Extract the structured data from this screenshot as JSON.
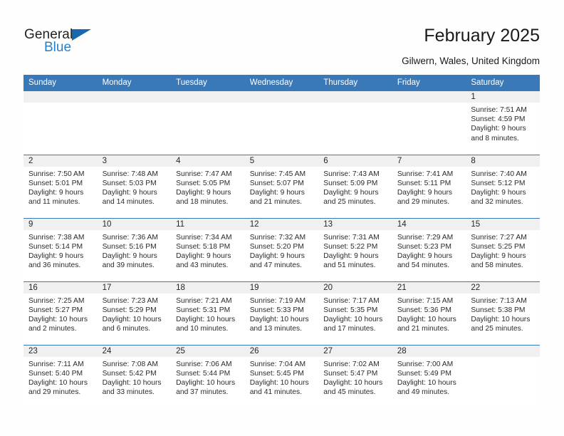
{
  "brand": {
    "name_top": "General",
    "name_bottom": "Blue",
    "color_dark": "#231f20",
    "color_blue": "#2a7fc4"
  },
  "header": {
    "title": "February 2025",
    "subtitle": "Gilwern, Wales, United Kingdom",
    "accent_color": "#3a79b8"
  },
  "calendar": {
    "weekday_headers": [
      "Sunday",
      "Monday",
      "Tuesday",
      "Wednesday",
      "Thursday",
      "Friday",
      "Saturday"
    ],
    "weeks": [
      [
        {
          "day": "",
          "lines": []
        },
        {
          "day": "",
          "lines": []
        },
        {
          "day": "",
          "lines": []
        },
        {
          "day": "",
          "lines": []
        },
        {
          "day": "",
          "lines": []
        },
        {
          "day": "",
          "lines": []
        },
        {
          "day": "1",
          "lines": [
            "Sunrise: 7:51 AM",
            "Sunset: 4:59 PM",
            "Daylight: 9 hours and 8 minutes."
          ]
        }
      ],
      [
        {
          "day": "2",
          "lines": [
            "Sunrise: 7:50 AM",
            "Sunset: 5:01 PM",
            "Daylight: 9 hours and 11 minutes."
          ]
        },
        {
          "day": "3",
          "lines": [
            "Sunrise: 7:48 AM",
            "Sunset: 5:03 PM",
            "Daylight: 9 hours and 14 minutes."
          ]
        },
        {
          "day": "4",
          "lines": [
            "Sunrise: 7:47 AM",
            "Sunset: 5:05 PM",
            "Daylight: 9 hours and 18 minutes."
          ]
        },
        {
          "day": "5",
          "lines": [
            "Sunrise: 7:45 AM",
            "Sunset: 5:07 PM",
            "Daylight: 9 hours and 21 minutes."
          ]
        },
        {
          "day": "6",
          "lines": [
            "Sunrise: 7:43 AM",
            "Sunset: 5:09 PM",
            "Daylight: 9 hours and 25 minutes."
          ]
        },
        {
          "day": "7",
          "lines": [
            "Sunrise: 7:41 AM",
            "Sunset: 5:11 PM",
            "Daylight: 9 hours and 29 minutes."
          ]
        },
        {
          "day": "8",
          "lines": [
            "Sunrise: 7:40 AM",
            "Sunset: 5:12 PM",
            "Daylight: 9 hours and 32 minutes."
          ]
        }
      ],
      [
        {
          "day": "9",
          "lines": [
            "Sunrise: 7:38 AM",
            "Sunset: 5:14 PM",
            "Daylight: 9 hours and 36 minutes."
          ]
        },
        {
          "day": "10",
          "lines": [
            "Sunrise: 7:36 AM",
            "Sunset: 5:16 PM",
            "Daylight: 9 hours and 39 minutes."
          ]
        },
        {
          "day": "11",
          "lines": [
            "Sunrise: 7:34 AM",
            "Sunset: 5:18 PM",
            "Daylight: 9 hours and 43 minutes."
          ]
        },
        {
          "day": "12",
          "lines": [
            "Sunrise: 7:32 AM",
            "Sunset: 5:20 PM",
            "Daylight: 9 hours and 47 minutes."
          ]
        },
        {
          "day": "13",
          "lines": [
            "Sunrise: 7:31 AM",
            "Sunset: 5:22 PM",
            "Daylight: 9 hours and 51 minutes."
          ]
        },
        {
          "day": "14",
          "lines": [
            "Sunrise: 7:29 AM",
            "Sunset: 5:23 PM",
            "Daylight: 9 hours and 54 minutes."
          ]
        },
        {
          "day": "15",
          "lines": [
            "Sunrise: 7:27 AM",
            "Sunset: 5:25 PM",
            "Daylight: 9 hours and 58 minutes."
          ]
        }
      ],
      [
        {
          "day": "16",
          "lines": [
            "Sunrise: 7:25 AM",
            "Sunset: 5:27 PM",
            "Daylight: 10 hours and 2 minutes."
          ]
        },
        {
          "day": "17",
          "lines": [
            "Sunrise: 7:23 AM",
            "Sunset: 5:29 PM",
            "Daylight: 10 hours and 6 minutes."
          ]
        },
        {
          "day": "18",
          "lines": [
            "Sunrise: 7:21 AM",
            "Sunset: 5:31 PM",
            "Daylight: 10 hours and 10 minutes."
          ]
        },
        {
          "day": "19",
          "lines": [
            "Sunrise: 7:19 AM",
            "Sunset: 5:33 PM",
            "Daylight: 10 hours and 13 minutes."
          ]
        },
        {
          "day": "20",
          "lines": [
            "Sunrise: 7:17 AM",
            "Sunset: 5:35 PM",
            "Daylight: 10 hours and 17 minutes."
          ]
        },
        {
          "day": "21",
          "lines": [
            "Sunrise: 7:15 AM",
            "Sunset: 5:36 PM",
            "Daylight: 10 hours and 21 minutes."
          ]
        },
        {
          "day": "22",
          "lines": [
            "Sunrise: 7:13 AM",
            "Sunset: 5:38 PM",
            "Daylight: 10 hours and 25 minutes."
          ]
        }
      ],
      [
        {
          "day": "23",
          "lines": [
            "Sunrise: 7:11 AM",
            "Sunset: 5:40 PM",
            "Daylight: 10 hours and 29 minutes."
          ]
        },
        {
          "day": "24",
          "lines": [
            "Sunrise: 7:08 AM",
            "Sunset: 5:42 PM",
            "Daylight: 10 hours and 33 minutes."
          ]
        },
        {
          "day": "25",
          "lines": [
            "Sunrise: 7:06 AM",
            "Sunset: 5:44 PM",
            "Daylight: 10 hours and 37 minutes."
          ]
        },
        {
          "day": "26",
          "lines": [
            "Sunrise: 7:04 AM",
            "Sunset: 5:45 PM",
            "Daylight: 10 hours and 41 minutes."
          ]
        },
        {
          "day": "27",
          "lines": [
            "Sunrise: 7:02 AM",
            "Sunset: 5:47 PM",
            "Daylight: 10 hours and 45 minutes."
          ]
        },
        {
          "day": "28",
          "lines": [
            "Sunrise: 7:00 AM",
            "Sunset: 5:49 PM",
            "Daylight: 10 hours and 49 minutes."
          ]
        },
        {
          "day": "",
          "lines": []
        }
      ]
    ]
  }
}
